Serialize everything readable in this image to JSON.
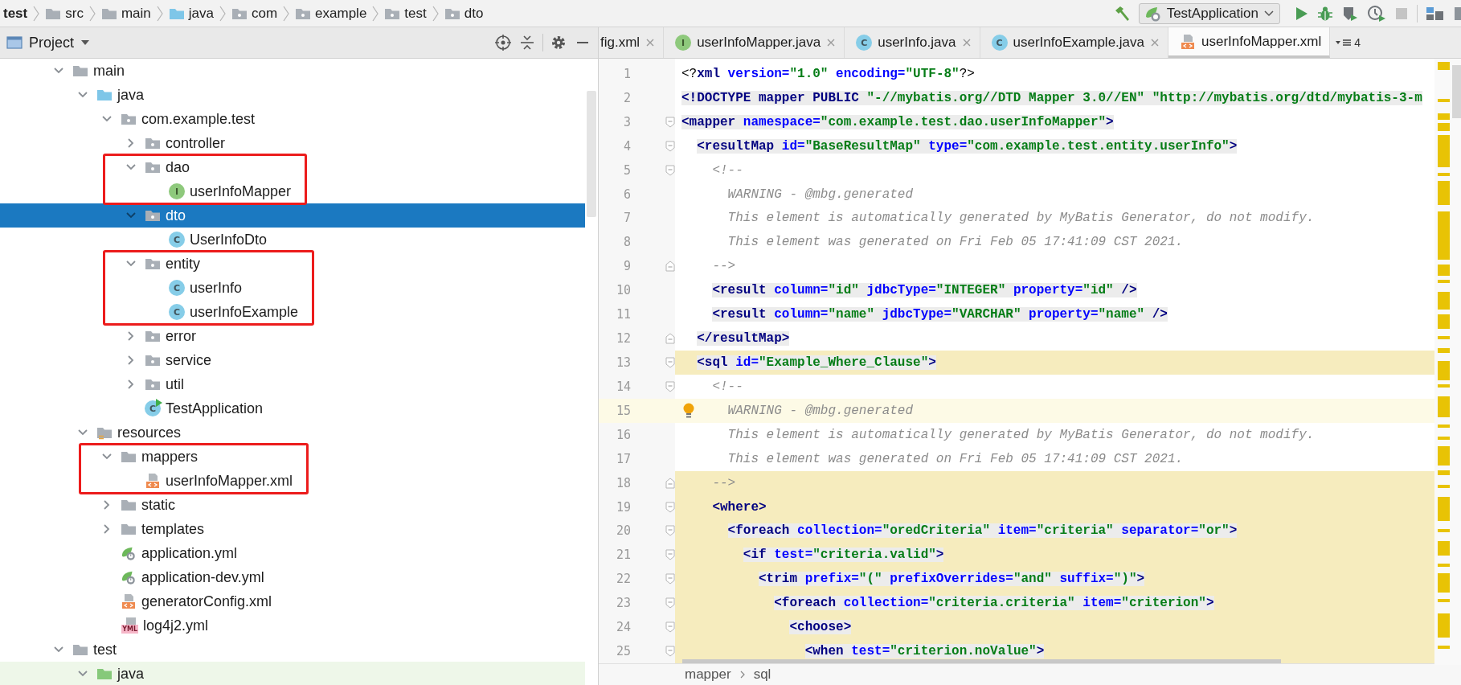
{
  "breadcrumbs": [
    {
      "label": "test",
      "kind": "project"
    },
    {
      "label": "src",
      "kind": "folder"
    },
    {
      "label": "main",
      "kind": "folder"
    },
    {
      "label": "java",
      "kind": "source"
    },
    {
      "label": "com",
      "kind": "package"
    },
    {
      "label": "example",
      "kind": "package"
    },
    {
      "label": "test",
      "kind": "package"
    },
    {
      "label": "dto",
      "kind": "package"
    }
  ],
  "run_toolbar": [
    {
      "kind": "build",
      "disabled": false
    },
    {
      "kind": "config",
      "label": "TestApplication",
      "disabled": false
    },
    {
      "kind": "run",
      "disabled": false
    },
    {
      "kind": "debug",
      "disabled": false
    },
    {
      "kind": "coverage",
      "disabled": false
    },
    {
      "kind": "profile",
      "disabled": false
    },
    {
      "kind": "stop",
      "disabled": true
    },
    {
      "kind": "separator"
    },
    {
      "kind": "structure",
      "disabled": false
    },
    {
      "kind": "layout",
      "disabled": false
    }
  ],
  "project": {
    "title": "Project",
    "tree": [
      {
        "label": "main",
        "kind": "folder",
        "expanded": true,
        "selected": false,
        "highlighted": false,
        "children": [
          {
            "label": "java",
            "kind": "source",
            "expanded": true,
            "selected": false,
            "highlighted": false,
            "children": [
              {
                "label": "com.example.test",
                "kind": "package",
                "expanded": true,
                "selected": false,
                "highlighted": false,
                "children": [
                  {
                    "label": "controller",
                    "kind": "package",
                    "expanded": false,
                    "selected": false,
                    "highlighted": false
                  },
                  {
                    "label": "dao",
                    "kind": "package",
                    "expanded": true,
                    "selected": false,
                    "highlighted": true,
                    "children": [
                      {
                        "label": "userInfoMapper",
                        "kind": "interface",
                        "badge": "I",
                        "selected": false,
                        "highlighted": true
                      }
                    ]
                  },
                  {
                    "label": "dto",
                    "kind": "package",
                    "expanded": true,
                    "selected": true,
                    "highlighted": false,
                    "children": [
                      {
                        "label": "UserInfoDto",
                        "kind": "class",
                        "badge": "C",
                        "selected": false,
                        "highlighted": false
                      }
                    ]
                  },
                  {
                    "label": "entity",
                    "kind": "package",
                    "expanded": true,
                    "selected": false,
                    "highlighted": true,
                    "children": [
                      {
                        "label": "userInfo",
                        "kind": "class",
                        "badge": "C",
                        "selected": false,
                        "highlighted": true
                      },
                      {
                        "label": "userInfoExample",
                        "kind": "class",
                        "badge": "C",
                        "selected": false,
                        "highlighted": true
                      }
                    ]
                  },
                  {
                    "label": "error",
                    "kind": "package",
                    "expanded": false,
                    "selected": false,
                    "highlighted": false
                  },
                  {
                    "label": "service",
                    "kind": "package",
                    "expanded": false,
                    "selected": false,
                    "highlighted": false
                  },
                  {
                    "label": "util",
                    "kind": "package",
                    "expanded": false,
                    "selected": false,
                    "highlighted": false
                  },
                  {
                    "label": "TestApplication",
                    "kind": "app",
                    "badge": "C",
                    "selected": false,
                    "highlighted": false
                  }
                ]
              }
            ]
          },
          {
            "label": "resources",
            "kind": "resources",
            "expanded": true,
            "selected": false,
            "highlighted": false,
            "children": [
              {
                "label": "mappers",
                "kind": "folder",
                "expanded": true,
                "selected": false,
                "highlighted": true,
                "children": [
                  {
                    "label": "userInfoMapper.xml",
                    "kind": "xml",
                    "selected": false,
                    "highlighted": true
                  }
                ]
              },
              {
                "label": "static",
                "kind": "folder",
                "expanded": false,
                "selected": false,
                "highlighted": false
              },
              {
                "label": "templates",
                "kind": "folder",
                "expanded": false,
                "selected": false,
                "highlighted": false
              },
              {
                "label": "application.yml",
                "kind": "spring-yml",
                "selected": false,
                "highlighted": false
              },
              {
                "label": "application-dev.yml",
                "kind": "spring-yml",
                "selected": false,
                "highlighted": false
              },
              {
                "label": "generatorConfig.xml",
                "kind": "xml",
                "selected": false,
                "highlighted": false
              },
              {
                "label": "log4j2.yml",
                "kind": "yml",
                "badge": "YML",
                "selected": false,
                "highlighted": false
              }
            ]
          }
        ]
      },
      {
        "label": "test",
        "kind": "folder",
        "expanded": true,
        "selected": false,
        "highlighted": false,
        "children": [
          {
            "label": "java",
            "kind": "test-source",
            "expanded": true,
            "selected": false,
            "highlighted": false
          }
        ]
      }
    ]
  },
  "editor": {
    "tabs": [
      {
        "label": "fig.xml",
        "kind": "plain",
        "selected": false,
        "closable": true
      },
      {
        "label": "userInfoMapper.java",
        "kind": "interface",
        "badge": "I",
        "selected": false,
        "closable": true
      },
      {
        "label": "userInfo.java",
        "kind": "class",
        "badge": "C",
        "selected": false,
        "closable": true
      },
      {
        "label": "userInfoExample.java",
        "kind": "class",
        "badge": "C",
        "selected": false,
        "closable": true
      },
      {
        "label": "userInfoMapper.xml",
        "kind": "xml",
        "selected": true,
        "closable": false
      }
    ],
    "hidden_tabs_count": "4",
    "lines": [
      {
        "number": "1",
        "kind": "plain",
        "shaded": false,
        "highlighted": false,
        "current": false,
        "tokens": [
          {
            "kind": "plain",
            "text": "<?"
          },
          {
            "kind": "tag",
            "text": "xml"
          },
          {
            "kind": "attr",
            "text": " version="
          },
          {
            "kind": "value",
            "text": "\"1.0\""
          },
          {
            "kind": "attr",
            "text": " encoding="
          },
          {
            "kind": "value",
            "text": "\"UTF-8\""
          },
          {
            "kind": "plain",
            "text": "?>"
          }
        ]
      },
      {
        "number": "2",
        "kind": "plain",
        "shaded": true,
        "highlighted": false,
        "current": false,
        "tokens": [
          {
            "kind": "tag",
            "text": "<!DOCTYPE mapper PUBLIC "
          },
          {
            "kind": "value",
            "text": "\"-//mybatis.org//DTD Mapper 3.0//EN\" \"http://mybatis.org/dtd/mybatis-3-m"
          }
        ]
      },
      {
        "number": "3",
        "kind": "fold-start",
        "shaded": true,
        "highlighted": false,
        "current": false,
        "tokens": [
          {
            "kind": "tag",
            "text": "<mapper"
          },
          {
            "kind": "attr",
            "text": " namespace="
          },
          {
            "kind": "value",
            "text": "\"com.example.test.dao.userInfoMapper\""
          },
          {
            "kind": "tag",
            "text": ">"
          }
        ]
      },
      {
        "number": "4",
        "kind": "fold-start",
        "shaded": true,
        "highlighted": false,
        "current": false,
        "tokens": [
          {
            "kind": "tag",
            "text": "  <resultMap"
          },
          {
            "kind": "attr",
            "text": " id="
          },
          {
            "kind": "value",
            "text": "\"BaseResultMap\""
          },
          {
            "kind": "attr",
            "text": " type="
          },
          {
            "kind": "value",
            "text": "\"com.example.test.entity.userInfo\""
          },
          {
            "kind": "tag",
            "text": ">"
          }
        ]
      },
      {
        "number": "5",
        "kind": "fold-start",
        "shaded": false,
        "highlighted": false,
        "current": false,
        "tokens": [
          {
            "kind": "comment",
            "text": "    <!--"
          }
        ]
      },
      {
        "number": "6",
        "kind": "plain",
        "shaded": false,
        "highlighted": false,
        "current": false,
        "tokens": [
          {
            "kind": "comment",
            "text": "      WARNING - @mbg.generated"
          }
        ]
      },
      {
        "number": "7",
        "kind": "plain",
        "shaded": false,
        "highlighted": false,
        "current": false,
        "tokens": [
          {
            "kind": "comment",
            "text": "      This element is automatically generated by MyBatis Generator, do not modify."
          }
        ]
      },
      {
        "number": "8",
        "kind": "plain",
        "shaded": false,
        "highlighted": false,
        "current": false,
        "tokens": [
          {
            "kind": "comment",
            "text": "      This element was generated on Fri Feb 05 17:41:09 CST 2021."
          }
        ]
      },
      {
        "number": "9",
        "kind": "fold-end",
        "shaded": false,
        "highlighted": false,
        "current": false,
        "tokens": [
          {
            "kind": "comment",
            "text": "    -->"
          }
        ]
      },
      {
        "number": "10",
        "kind": "plain",
        "shaded": true,
        "highlighted": false,
        "current": false,
        "tokens": [
          {
            "kind": "tag",
            "text": "    <result"
          },
          {
            "kind": "attr",
            "text": " column="
          },
          {
            "kind": "value",
            "text": "\"id\""
          },
          {
            "kind": "attr",
            "text": " jdbcType="
          },
          {
            "kind": "value",
            "text": "\"INTEGER\""
          },
          {
            "kind": "attr",
            "text": " property="
          },
          {
            "kind": "value",
            "text": "\"id\""
          },
          {
            "kind": "tag",
            "text": " />"
          }
        ]
      },
      {
        "number": "11",
        "kind": "plain",
        "shaded": true,
        "highlighted": false,
        "current": false,
        "tokens": [
          {
            "kind": "tag",
            "text": "    <result"
          },
          {
            "kind": "attr",
            "text": " column="
          },
          {
            "kind": "value",
            "text": "\"name\""
          },
          {
            "kind": "attr",
            "text": " jdbcType="
          },
          {
            "kind": "value",
            "text": "\"VARCHAR\""
          },
          {
            "kind": "attr",
            "text": " property="
          },
          {
            "kind": "value",
            "text": "\"name\""
          },
          {
            "kind": "tag",
            "text": " />"
          }
        ]
      },
      {
        "number": "12",
        "kind": "fold-end",
        "shaded": true,
        "highlighted": false,
        "current": false,
        "tokens": [
          {
            "kind": "tag",
            "text": "  </resultMap>"
          }
        ]
      },
      {
        "number": "13",
        "kind": "fold-start",
        "shaded": true,
        "highlighted": true,
        "current": false,
        "tokens": [
          {
            "kind": "tag",
            "text": "  <sql"
          },
          {
            "kind": "attr",
            "text": " id="
          },
          {
            "kind": "value",
            "text": "\"Example_Where_Clause\""
          },
          {
            "kind": "tag",
            "text": ">"
          }
        ]
      },
      {
        "number": "14",
        "kind": "fold-start",
        "shaded": false,
        "highlighted": false,
        "current": false,
        "tokens": [
          {
            "kind": "comment",
            "text": "    <!--"
          }
        ]
      },
      {
        "number": "15",
        "kind": "plain",
        "shaded": false,
        "highlighted": false,
        "current": true,
        "tokens": [
          {
            "kind": "comment",
            "text": "      WARNING - @mbg.generated"
          }
        ]
      },
      {
        "number": "16",
        "kind": "plain",
        "shaded": false,
        "highlighted": false,
        "current": false,
        "tokens": [
          {
            "kind": "comment",
            "text": "      This element is automatically generated by MyBatis Generator, do not modify."
          }
        ]
      },
      {
        "number": "17",
        "kind": "plain",
        "shaded": false,
        "highlighted": false,
        "current": false,
        "tokens": [
          {
            "kind": "comment",
            "text": "      This element was generated on Fri Feb 05 17:41:09 CST 2021."
          }
        ]
      },
      {
        "number": "18",
        "kind": "fold-end",
        "shaded": false,
        "highlighted": true,
        "current": false,
        "tokens": [
          {
            "kind": "comment",
            "text": "    -->"
          }
        ]
      },
      {
        "number": "19",
        "kind": "fold-start",
        "shaded": false,
        "highlighted": true,
        "current": false,
        "tokens": [
          {
            "kind": "tag",
            "text": "    <where>"
          }
        ]
      },
      {
        "number": "20",
        "kind": "fold-start",
        "shaded": true,
        "highlighted": true,
        "current": false,
        "tokens": [
          {
            "kind": "tag",
            "text": "      <foreach"
          },
          {
            "kind": "attr",
            "text": " collection="
          },
          {
            "kind": "value",
            "text": "\"oredCriteria\""
          },
          {
            "kind": "attr",
            "text": " item="
          },
          {
            "kind": "value",
            "text": "\"criteria\""
          },
          {
            "kind": "attr",
            "text": " separator="
          },
          {
            "kind": "value",
            "text": "\"or\""
          },
          {
            "kind": "tag",
            "text": ">"
          }
        ]
      },
      {
        "number": "21",
        "kind": "fold-start",
        "shaded": true,
        "highlighted": true,
        "current": false,
        "tokens": [
          {
            "kind": "tag",
            "text": "        <if"
          },
          {
            "kind": "attr",
            "text": " test="
          },
          {
            "kind": "value",
            "text": "\"criteria.valid\""
          },
          {
            "kind": "tag",
            "text": ">"
          }
        ]
      },
      {
        "number": "22",
        "kind": "fold-start",
        "shaded": true,
        "highlighted": true,
        "current": false,
        "tokens": [
          {
            "kind": "tag",
            "text": "          <trim"
          },
          {
            "kind": "attr",
            "text": " prefix="
          },
          {
            "kind": "value",
            "text": "\"(\""
          },
          {
            "kind": "attr",
            "text": " prefixOverrides="
          },
          {
            "kind": "value",
            "text": "\"and\""
          },
          {
            "kind": "attr",
            "text": " suffix="
          },
          {
            "kind": "value",
            "text": "\")\""
          },
          {
            "kind": "tag",
            "text": ">"
          }
        ]
      },
      {
        "number": "23",
        "kind": "fold-start",
        "shaded": true,
        "highlighted": true,
        "current": false,
        "tokens": [
          {
            "kind": "tag",
            "text": "            <foreach"
          },
          {
            "kind": "attr",
            "text": " collection="
          },
          {
            "kind": "value",
            "text": "\"criteria.criteria\""
          },
          {
            "kind": "attr",
            "text": " item="
          },
          {
            "kind": "value",
            "text": "\"criterion\""
          },
          {
            "kind": "tag",
            "text": ">"
          }
        ]
      },
      {
        "number": "24",
        "kind": "fold-start",
        "shaded": true,
        "highlighted": true,
        "current": false,
        "tokens": [
          {
            "kind": "tag",
            "text": "              <choose>"
          }
        ]
      },
      {
        "number": "25",
        "kind": "fold-start",
        "shaded": true,
        "highlighted": true,
        "current": false,
        "tokens": [
          {
            "kind": "tag",
            "text": "                <when"
          },
          {
            "kind": "attr",
            "text": " test="
          },
          {
            "kind": "value",
            "text": "\"criterion.noValue\""
          },
          {
            "kind": "tag",
            "text": ">"
          }
        ]
      }
    ],
    "path": [
      "mapper",
      "sql"
    ]
  }
}
